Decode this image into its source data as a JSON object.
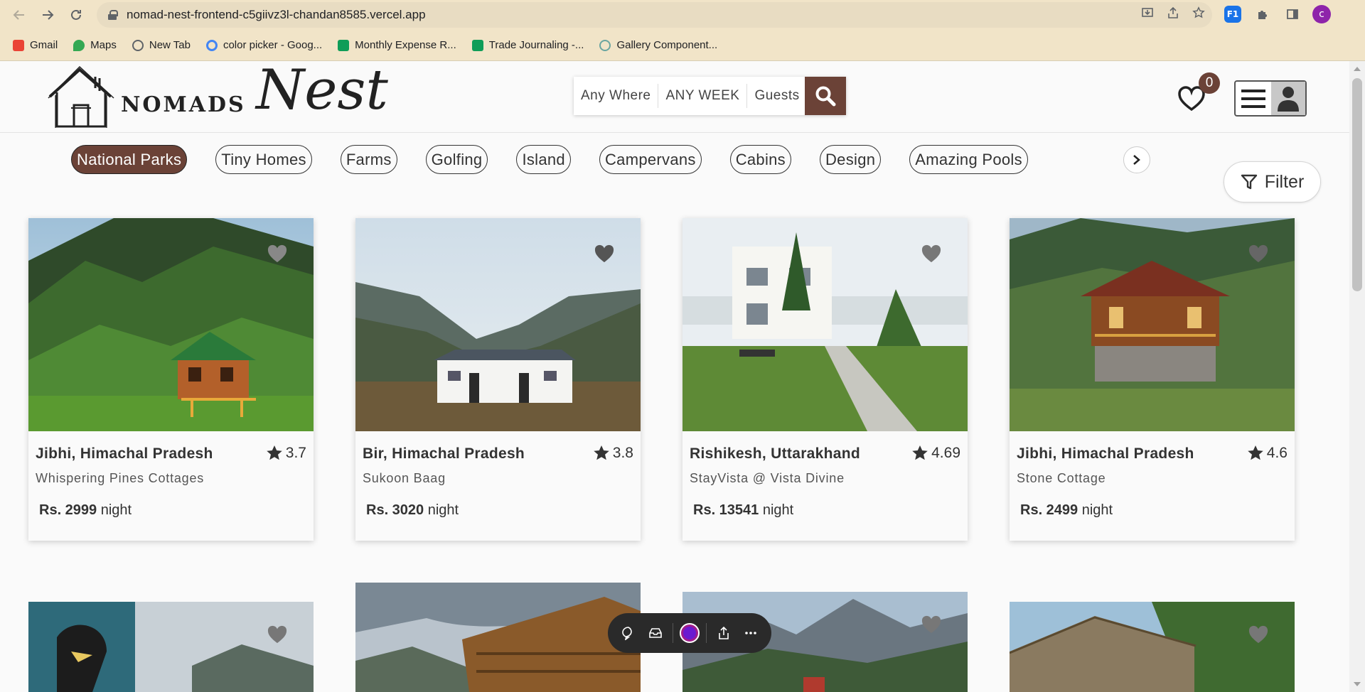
{
  "browser": {
    "url": "nomad-nest-frontend-c5giivz3l-chandan8585.vercel.app",
    "profile_initial": "c",
    "ext_label": "F1",
    "bookmarks": [
      {
        "label": "Gmail",
        "color": "#ea4335"
      },
      {
        "label": "Maps",
        "color": "#34a853"
      },
      {
        "label": "New Tab",
        "color": "#5f6368"
      },
      {
        "label": "color picker - Goog...",
        "color": "#4285f4"
      },
      {
        "label": "Monthly Expense R...",
        "color": "#0f9d58"
      },
      {
        "label": "Trade Journaling -...",
        "color": "#0f9d58"
      },
      {
        "label": "Gallery Component...",
        "color": "#6aa5a0"
      }
    ]
  },
  "header": {
    "logo_word": "NOMADS",
    "logo_script": "Nest",
    "search": {
      "where": "Any Where",
      "week": "ANY WEEK",
      "guests": "Guests"
    },
    "wishlist_count": "0"
  },
  "categories": {
    "items": [
      "National Parks",
      "Tiny Homes",
      "Farms",
      "Golfing",
      "Island",
      "Campervans",
      "Cabins",
      "Design",
      "Amazing Pools"
    ],
    "active_index": 0
  },
  "filter": {
    "label": "Filter"
  },
  "listings": [
    {
      "location": "Jibhi, Himachal Pradesh",
      "rating": "3.7",
      "name": "Whispering Pines Cottages",
      "price": "Rs. 2999",
      "unit": "night"
    },
    {
      "location": "Bir, Himachal Pradesh",
      "rating": "3.8",
      "name": "Sukoon Baag",
      "price": "Rs. 3020",
      "unit": "night"
    },
    {
      "location": "Rishikesh, Uttarakhand",
      "rating": "4.69",
      "name": "StayVista @ Vista Divine",
      "price": "Rs. 13541",
      "unit": "night"
    },
    {
      "location": "Jibhi, Himachal Pradesh",
      "rating": "4.6",
      "name": "Stone Cottage",
      "price": "Rs. 2499",
      "unit": "night"
    }
  ],
  "colors": {
    "brand": "#6b4237",
    "chrome": "#f1e4c8"
  }
}
